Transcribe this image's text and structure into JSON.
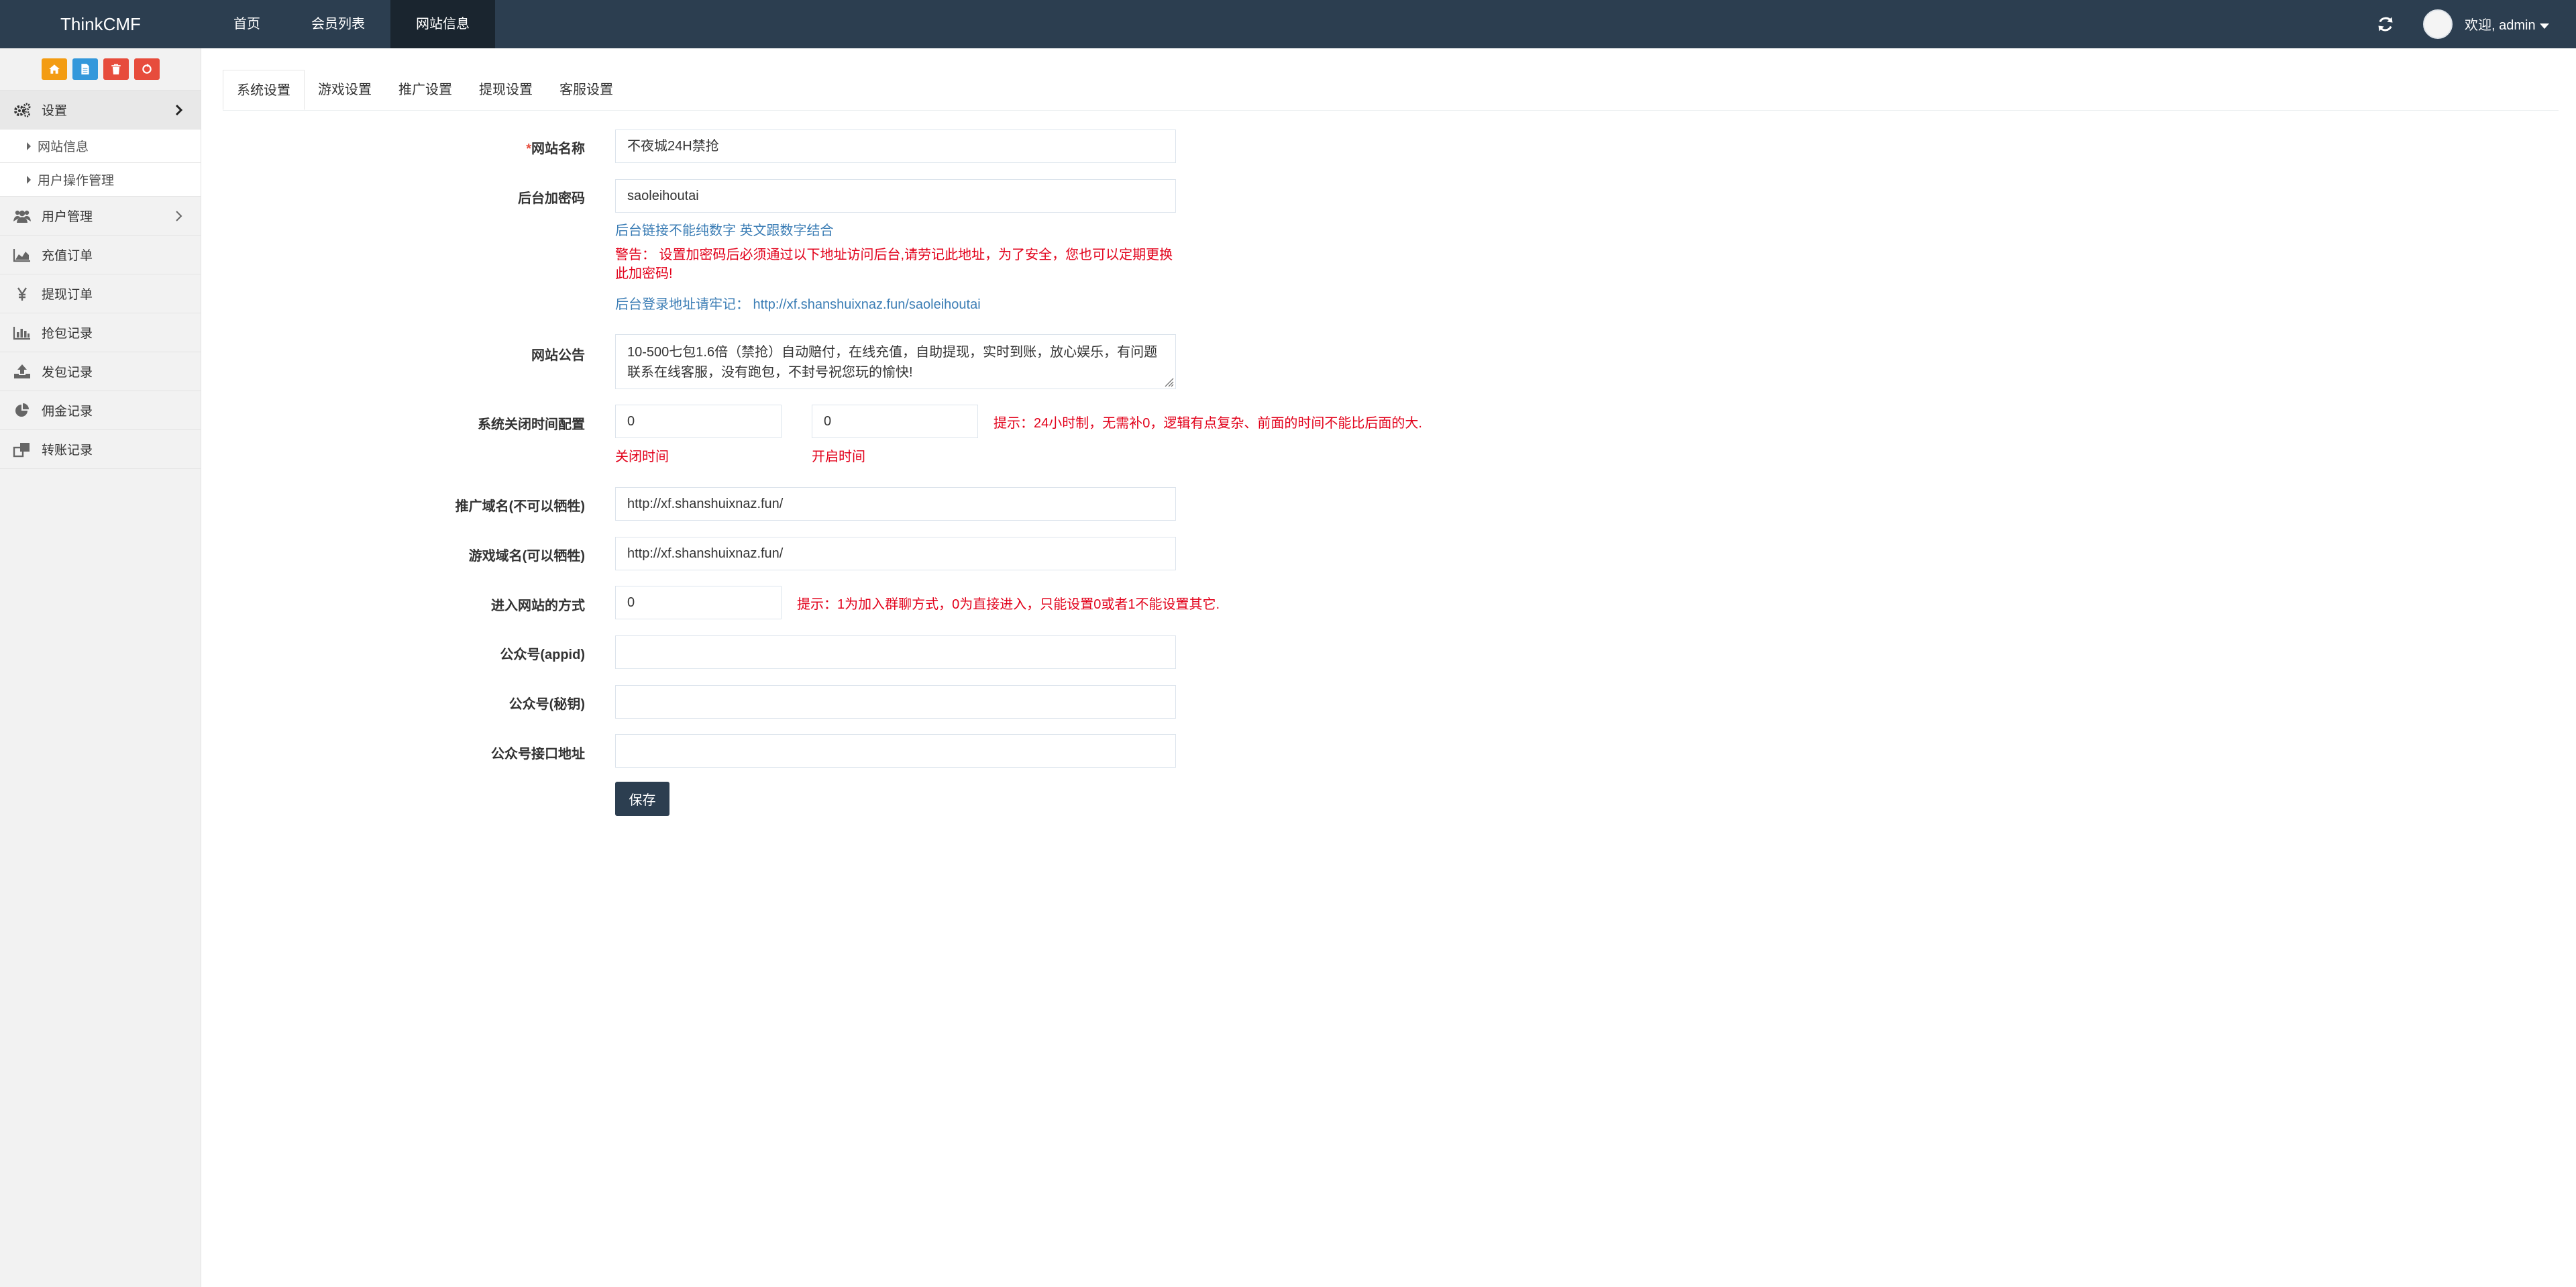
{
  "header": {
    "brand": "ThinkCMF",
    "nav": [
      "首页",
      "会员列表",
      "网站信息"
    ],
    "welcome": "欢迎, admin"
  },
  "sidebar": {
    "shortcut_colors": [
      "#f39c12",
      "#3498db",
      "#e74c3c",
      "#e74c3c"
    ],
    "settings": "设置",
    "sub_items": [
      "网站信息",
      "用户操作管理"
    ],
    "items": [
      "用户管理",
      "充值订单",
      "提现订单",
      "抢包记录",
      "发包记录",
      "佣金记录",
      "转账记录"
    ]
  },
  "tabs": [
    "系统设置",
    "游戏设置",
    "推广设置",
    "提现设置",
    "客服设置"
  ],
  "form": {
    "site_name": {
      "required": "*",
      "label": "网站名称",
      "value": "不夜城24H禁抢"
    },
    "admin_secret": {
      "label": "后台加密码",
      "value": "saoleihoutai",
      "hint": "后台链接不能纯数字 英文跟数字结合",
      "warning": "警告： 设置加密码后必须通过以下地址访问后台,请劳记此地址，为了安全，您也可以定期更换此加密码!",
      "login_hint": "后台登录地址请牢记： http://xf.shanshuixnaz.fun/saoleihoutai"
    },
    "notice": {
      "label": "网站公告",
      "value": "10-500七包1.6倍（禁抢）自动赔付，在线充值，自助提现，实时到账，放心娱乐，有问题联系在线客服，没有跑包，不封号祝您玩的愉快!"
    },
    "close_time": {
      "label": "系统关闭时间配置",
      "close_value": "0",
      "open_value": "0",
      "close_label": "关闭时间",
      "open_label": "开启时间",
      "tip": "提示：24小时制，无需补0，逻辑有点复杂、前面的时间不能比后面的大."
    },
    "promo_domain": {
      "label": "推广域名(不可以牺牲)",
      "value": "http://xf.shanshuixnaz.fun/"
    },
    "game_domain": {
      "label": "游戏域名(可以牺牲)",
      "value": "http://xf.shanshuixnaz.fun/"
    },
    "enter_mode": {
      "label": "进入网站的方式",
      "value": "0",
      "tip": "提示：1为加入群聊方式，0为直接进入，只能设置0或者1不能设置其它."
    },
    "appid": {
      "label": "公众号(appid)",
      "value": ""
    },
    "secret": {
      "label": "公众号(秘钥)",
      "value": ""
    },
    "api_url": {
      "label": "公众号接口地址",
      "value": ""
    },
    "save": "保存"
  }
}
